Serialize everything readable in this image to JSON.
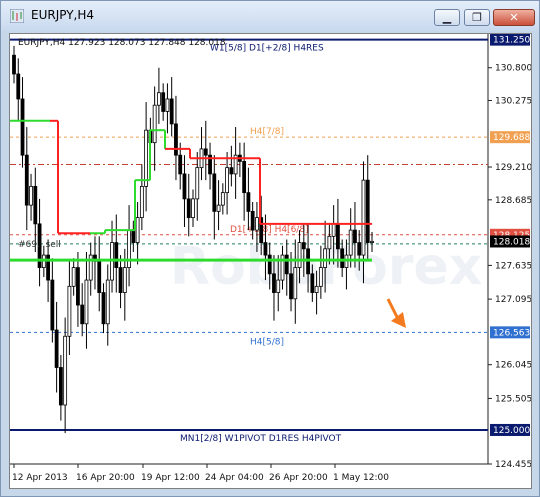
{
  "window": {
    "title": "EURJPY,H4",
    "buttons": [
      "minimize",
      "maximize",
      "close"
    ]
  },
  "chart_data": {
    "type": "candlestick",
    "symbol_info": "EURJPY,H4  127.923 128.073 127.848 128.018",
    "ylim": [
      124.455,
      131.34
    ],
    "price_axis_labels": [
      "130.800",
      "130.275",
      "129.210",
      "128.685",
      "127.635",
      "127.095",
      "126.045",
      "125.505",
      "124.455"
    ],
    "highlighted_prices": {
      "res": "131.250",
      "h4_7_8": "129.688",
      "current_red": "128.125",
      "current_black": "128.018",
      "h4_5_8": "126.563",
      "pivot": "125.000"
    },
    "time_axis_labels": [
      "12 Apr 2013",
      "16 Apr 20:00",
      "19 Apr 12:00",
      "24 Apr 04:00",
      "26 Apr 20:00",
      "1 May 12:00"
    ],
    "levels": [
      {
        "price": 131.25,
        "label": "W1[5/8] D1[+2/8] H4RES",
        "color": "#0a1a6e"
      },
      {
        "price": 129.688,
        "label": "H4[7/8]",
        "color": "#f0a050"
      },
      {
        "price": 129.25,
        "label": "",
        "color": "#c04030"
      },
      {
        "price": 128.125,
        "label": "D1[+1/8] H4[6/8]",
        "color": "#e05040"
      },
      {
        "price": 127.98,
        "label": "",
        "color": "#208060"
      },
      {
        "price": 126.563,
        "label": "H4[5/8]",
        "color": "#3070d0"
      },
      {
        "price": 125.0,
        "label": "MN1[2/8] W1PIVOT D1RES H4PIVOT",
        "color": "#0a1a6e"
      }
    ],
    "order_label": "#69.. sell",
    "watermark": "RoboForex",
    "candles_close": [
      130.7,
      130.3,
      129.4,
      128.6,
      128.9,
      128.3,
      127.6,
      127.8,
      127.4,
      126.6,
      126.0,
      125.4,
      126.5,
      127.3,
      127.6,
      127.0,
      126.7,
      127.4,
      127.8,
      127.7,
      127.2,
      126.7,
      127.4,
      128.0,
      127.6,
      127.2,
      127.6,
      128.2,
      128.0,
      128.4,
      128.9,
      129.8,
      129.6,
      130.2,
      130.4,
      130.1,
      130.3,
      129.9,
      129.4,
      129.1,
      128.7,
      128.4,
      128.7,
      129.2,
      129.5,
      129.4,
      129.1,
      128.5,
      128.6,
      128.8,
      129.2,
      129.1,
      129.4,
      129.3,
      128.8,
      128.5,
      128.2,
      128.4,
      128.0,
      127.8,
      127.5,
      127.2,
      127.4,
      127.8,
      127.5,
      127.1,
      127.6,
      128.0,
      127.9,
      127.5,
      127.2,
      127.3,
      127.6,
      127.9,
      128.1,
      128.3,
      127.9,
      127.6,
      127.8,
      128.2,
      128.0,
      127.8,
      129.0,
      128.0,
      128.02
    ],
    "line_green_ref": 127.72
  }
}
